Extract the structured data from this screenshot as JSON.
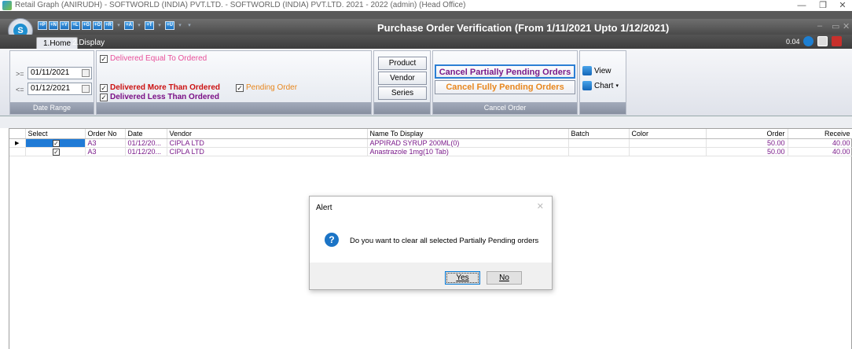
{
  "window": {
    "title": "Retail Graph (ANIRUDH) - SOFTWORLD (INDIA) PVT.LTD. - SOFTWORLD (INDIA) PVT.LTD. 2021 - 2022 (admin) (Head Office)",
    "minimize": "—",
    "maximize": "❐",
    "close": "✕"
  },
  "app": {
    "orb_label": "S",
    "qat_buttons": [
      "+P",
      "+N",
      "+Y",
      "+L",
      "+G",
      "+O",
      "+R",
      "+A",
      "+T",
      "+U"
    ],
    "inner_title": "Purchase Order Verification (From 1/11/2021 Upto 1/12/2021)",
    "status_value": "0.04"
  },
  "tabs": [
    {
      "label": "1.Home"
    },
    {
      "label": "2.Display"
    }
  ],
  "ribbon": {
    "date_range": {
      "from_op": ">=",
      "from": "01/11/2021",
      "to_op": "<=",
      "to": "01/12/2021",
      "caption": "Date Range"
    },
    "filters": {
      "delivered_equal": "Delivered Equal To Ordered",
      "delivered_more": "Delivered More Than Ordered",
      "pending": "Pending Order",
      "delivered_less": "Delivered Less Than Ordered"
    },
    "side_buttons": {
      "product": "Product",
      "vendor": "Vendor",
      "series": "Series"
    },
    "cancel": {
      "partial": "Cancel Partially Pending Orders",
      "fully": "Cancel Fully Pending Orders",
      "caption": "Cancel Order"
    },
    "view": {
      "view": "View",
      "chart": "Chart"
    },
    "colors": {
      "equal": "#e8509a",
      "more": "#cc1111",
      "less": "#7a0f86",
      "pending": "#e8871e",
      "partial": "#7a1a8a",
      "fully": "#e8871e"
    }
  },
  "grid": {
    "columns": [
      "Select",
      "Order No",
      "Date",
      "Vendor",
      "Name To Display",
      "Batch",
      "Color",
      "Order",
      "Receive"
    ],
    "rows": [
      {
        "order_no": "A3",
        "date": "01/12/20...",
        "vendor": "CIPLA LTD",
        "name": "APPIRAD SYRUP 200ML(0)",
        "batch": "",
        "color": "",
        "order": "50.00",
        "receive": "40.00"
      },
      {
        "order_no": "A3",
        "date": "01/12/20...",
        "vendor": "CIPLA LTD",
        "name": "Anastrazole 1mg(10 Tab)",
        "batch": "",
        "color": "",
        "order": "50.00",
        "receive": "40.00"
      }
    ]
  },
  "dialog": {
    "title": "Alert",
    "close": "✕",
    "message": "Do you want to clear all selected Partially Pending orders",
    "yes": "Yes",
    "no": "No"
  }
}
